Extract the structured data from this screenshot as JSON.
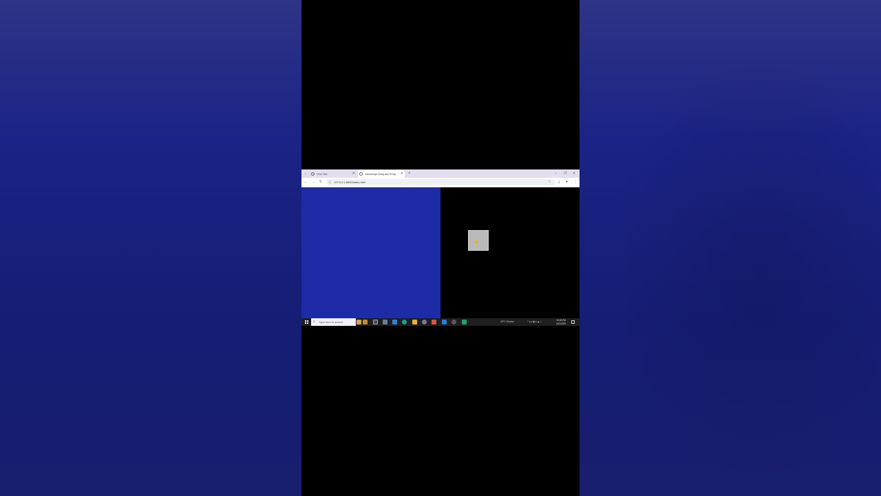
{
  "browser": {
    "tabs": [
      {
        "title": "New Tab",
        "active": false
      },
      {
        "title": "Javascript Drag and Drop",
        "active": true
      }
    ],
    "new_tab_glyph": "+",
    "address": {
      "url": "127.0.0.1:5500/index.html"
    },
    "toolbar_icons": [
      "back-icon",
      "forward-icon",
      "reload-icon",
      "info-icon",
      "star-icon",
      "download-icon",
      "profile-icon",
      "menu-icon"
    ]
  },
  "page": {
    "left_zone_color": "#1d2ba6",
    "right_zone_color": "#000000",
    "draggable_color": "#b9b9b9"
  },
  "taskbar": {
    "search_placeholder": "Type here to search",
    "weather": "29°C  Smoke",
    "time": "10:33 PM",
    "date": "10/1/2024"
  }
}
